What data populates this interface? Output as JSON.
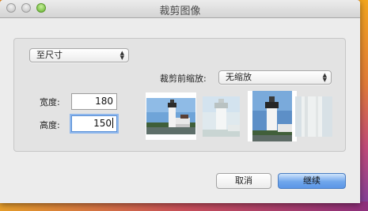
{
  "window": {
    "title": "裁剪图像"
  },
  "size_popup": {
    "selected": "至尺寸"
  },
  "scale_before_crop": {
    "label": "裁剪前缩放:",
    "selected": "无缩放"
  },
  "width": {
    "label": "宽度:",
    "value": "180"
  },
  "height": {
    "label": "高度:",
    "value": "150"
  },
  "buttons": {
    "cancel": "取消",
    "continue": "继续"
  },
  "colors": {
    "window_bg": "#ececec",
    "groupbox_bg": "#e3e3e3",
    "focus_ring": "#8fb7ec",
    "primary_button": "#5b96e6"
  }
}
